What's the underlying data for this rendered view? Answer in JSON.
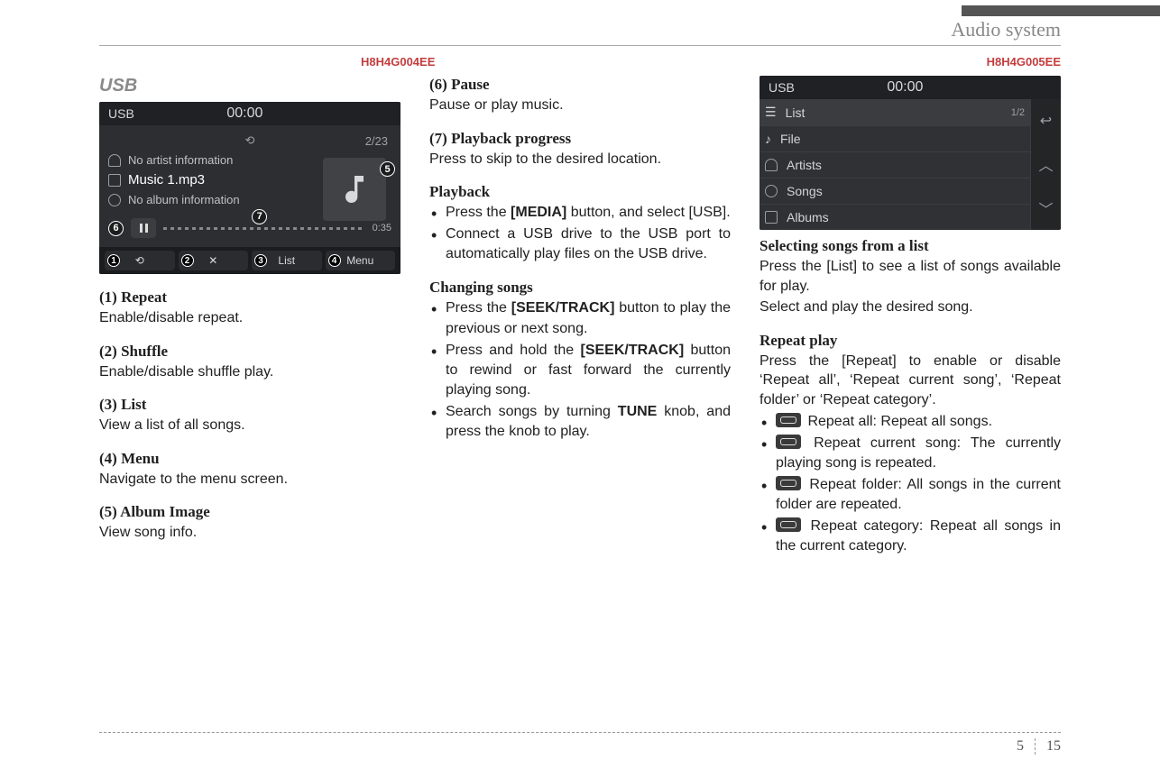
{
  "header": {
    "title": "Audio system"
  },
  "codes": {
    "left": "H8H4G004EE",
    "right": "H8H4G005EE"
  },
  "col1": {
    "usb_heading": "USB",
    "screen": {
      "source": "USB",
      "clock": "00:00",
      "track_of": "2/23",
      "artist_line": "No artist information",
      "now_playing": "Music 1.mp3",
      "album_line": "No album information",
      "elapsed": "0:35",
      "buttons": {
        "repeat_sym": "⟲",
        "shuffle_sym": "✕",
        "list": "List",
        "menu": "Menu"
      },
      "callouts": {
        "c5": "5",
        "c6": "6",
        "c7": "7",
        "b1": "1",
        "b2": "2",
        "b3": "3",
        "b4": "4"
      }
    },
    "items": [
      {
        "h": "(1) Repeat",
        "t": "Enable/disable repeat."
      },
      {
        "h": "(2) Shuffle",
        "t": "Enable/disable shuffle play."
      },
      {
        "h": "(3) List",
        "t": "View a list of all songs."
      },
      {
        "h": "(4) Menu",
        "t": "Navigate to the menu screen."
      },
      {
        "h": "(5) Album Image",
        "t": "View song info."
      }
    ]
  },
  "col2": {
    "items_top": [
      {
        "h": "(6) Pause",
        "t": "Pause or play music."
      },
      {
        "h": "(7) Playback progress",
        "t": "Press to skip to the desired location."
      }
    ],
    "playback_h": "Playback",
    "playback": {
      "b1_pre": "Press the ",
      "b1_bold": "[MEDIA]",
      "b1_post": " button, and select [USB].",
      "b2": "Connect a USB drive to the USB port to automatically play files on the USB drive."
    },
    "changing_h": "Changing songs",
    "changing": {
      "c1_pre": "Press the ",
      "c1_bold": "[SEEK/TRACK]",
      "c1_post": " button to play the previous or next song.",
      "c2_pre": "Press and hold the ",
      "c2_bold": "[SEEK/TRACK]",
      "c2_post": " button to rewind or fast forward the currently playing song.",
      "c3_pre": "Search songs by turning ",
      "c3_bold": "TUNE",
      "c3_post": " knob, and press the knob to play."
    }
  },
  "col3": {
    "screen": {
      "source": "USB",
      "clock": "00:00",
      "list_label": "List",
      "page": "1/2",
      "rows": {
        "r1": "File",
        "r2": "Artists",
        "r3": "Songs",
        "r4": "Albums"
      }
    },
    "sel_h": "Selecting songs from a list",
    "sel_t1": "Press the [List] to see a list of songs available for play.",
    "sel_t2": "Select and play the desired song.",
    "rep_h": "Repeat play",
    "rep_t": "Press the [Repeat] to enable or disable ‘Repeat all’, ‘Repeat current song’, ‘Repeat folder’ or ‘Repeat category’.",
    "rep_items": {
      "a": "Repeat all: Repeat all songs.",
      "b": "Repeat current song: The currently playing song is repeated.",
      "c": "Repeat folder: All songs in the current folder are repeated.",
      "d": "Repeat category: Repeat all songs in the current category."
    }
  },
  "footer": {
    "section": "5",
    "page": "15"
  }
}
